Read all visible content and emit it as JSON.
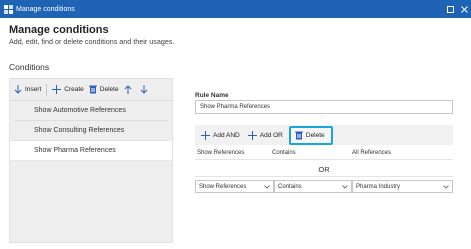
{
  "window": {
    "title": "Manage conditions"
  },
  "header": {
    "title": "Manage conditions",
    "subtitle": "Add, edit, find or delete conditions and their usages."
  },
  "conditions": {
    "label": "Conditions",
    "toolbar": {
      "insert": "Insert",
      "create": "Create",
      "delete": "Delete"
    },
    "items": [
      {
        "label": "Show Automotive References",
        "selected": false
      },
      {
        "label": "Show Consulting References",
        "selected": false
      },
      {
        "label": "Show Pharma References",
        "selected": true
      }
    ]
  },
  "rule": {
    "name_label": "Rule Name",
    "name_value": "Show Pharma References",
    "toolbar": {
      "add_and": "Add AND",
      "add_or": "Add OR",
      "delete": "Delete"
    },
    "headers": [
      "Show References",
      "Contains",
      "All References"
    ],
    "or_label": "OR",
    "row": {
      "field": "Show References",
      "operator": "Contains",
      "value": "Pharma Industry"
    }
  },
  "colors": {
    "titlebar": "#1f63b5",
    "highlight": "#18a7d8"
  }
}
